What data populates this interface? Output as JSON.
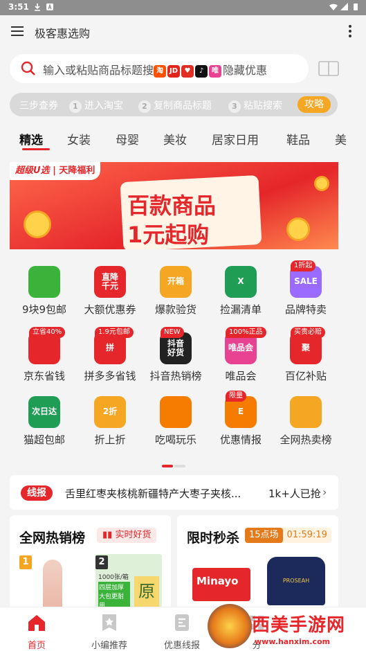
{
  "status": {
    "time": "3:51"
  },
  "appbar": {
    "title": "极客惠选购"
  },
  "search": {
    "placeholder_prefix": "输入或粘贴商品标题搜",
    "badges": [
      "淘",
      "JD",
      "",
      "",
      "唯"
    ],
    "placeholder_suffix": "隐藏优惠"
  },
  "steps": {
    "label": "三步查券",
    "items": [
      {
        "n": "1",
        "text": "进入淘宝"
      },
      {
        "n": "2",
        "text": "复制商品标题"
      },
      {
        "n": "3",
        "text": "粘贴搜索"
      }
    ],
    "tip": "攻略"
  },
  "tabs": [
    "精选",
    "女装",
    "母婴",
    "美妆",
    "居家日用",
    "鞋品",
    "美"
  ],
  "banner": {
    "tag_left": "超级U选",
    "tag_right": "天降福利",
    "line1": "百款商品",
    "line2": "1元起购"
  },
  "grid": [
    {
      "label": "9块9包邮",
      "icon": "cabbage-icon",
      "color": "#3bb33b"
    },
    {
      "label": "大额优惠券",
      "icon": "price-drop-icon",
      "color": "#e5262a",
      "icon_text": "直降\n千元"
    },
    {
      "label": "爆款验货",
      "icon": "open-box-icon",
      "color": "#f5a623",
      "icon_text": "开箱"
    },
    {
      "label": "捡漏清单",
      "icon": "excel-icon",
      "color": "#1f9d55",
      "icon_text": "X"
    },
    {
      "label": "品牌特卖",
      "icon": "shopping-bag-icon",
      "color": "#9b6bff",
      "badge": "1折起",
      "icon_text": "SALE"
    },
    {
      "label": "京东省钱",
      "icon": "jd-dog-icon",
      "color": "#e5262a",
      "badge": "立省40%"
    },
    {
      "label": "拼多多省钱",
      "icon": "pdd-icon",
      "color": "#e5262a",
      "badge": "1.9元包邮",
      "icon_text": "拼"
    },
    {
      "label": "抖音热销榜",
      "icon": "douyin-icon",
      "color": "#222222",
      "badge": "NEW",
      "icon_text": "抖音\n好货"
    },
    {
      "label": "唯品会",
      "icon": "vip-icon",
      "color": "#e84393",
      "badge": "100%正品",
      "icon_text": "唯品会"
    },
    {
      "label": "百亿补贴",
      "icon": "subsidy-icon",
      "color": "#e5262a",
      "badge": "买贵必赔",
      "icon_text": "聚"
    },
    {
      "label": "猫超包邮",
      "icon": "cat-market-icon",
      "color": "#1f9d55",
      "icon_text": "次日达"
    },
    {
      "label": "折上折",
      "icon": "discount-icon",
      "color": "#f5a623",
      "icon_text": "2折"
    },
    {
      "label": "吃喝玩乐",
      "icon": "food-icon",
      "color": "#f57c00"
    },
    {
      "label": "优惠情报",
      "icon": "info-icon",
      "color": "#f57c00",
      "badge": "限量",
      "icon_text": "E"
    },
    {
      "label": "全网热卖榜",
      "icon": "hot-rank-icon",
      "color": "#f5a623"
    }
  ],
  "news": {
    "tag": "线报",
    "text": "舌里红枣夹核桃新疆特产大枣子夹核...",
    "count": "1k+人已抢"
  },
  "hot": {
    "title": "全网热销榜",
    "pill": "实时好货",
    "ranks": [
      "1",
      "2"
    ],
    "prod2_top": "1000张/箱",
    "prod2_mid": "四层加厚\n大包更耐用",
    "prod2_big": "原"
  },
  "flash": {
    "title": "限时秒杀",
    "slot": "15点场",
    "countdown": "01:59:19",
    "prod1": "Minayo",
    "prod2": "PROSEAH"
  },
  "bottom_nav": [
    {
      "label": "首页",
      "icon": "home-icon",
      "active": true
    },
    {
      "label": "小编推荐",
      "icon": "star-badge-icon"
    },
    {
      "label": "优惠线报",
      "icon": "news-icon"
    },
    {
      "label": "分",
      "icon": "category-icon"
    }
  ],
  "watermark": {
    "title": "西美手游网",
    "url": "www.hanxim.com"
  },
  "colors": {
    "accent": "#e5262a",
    "orange": "#f5a623",
    "bg": "#f4f4f4"
  }
}
